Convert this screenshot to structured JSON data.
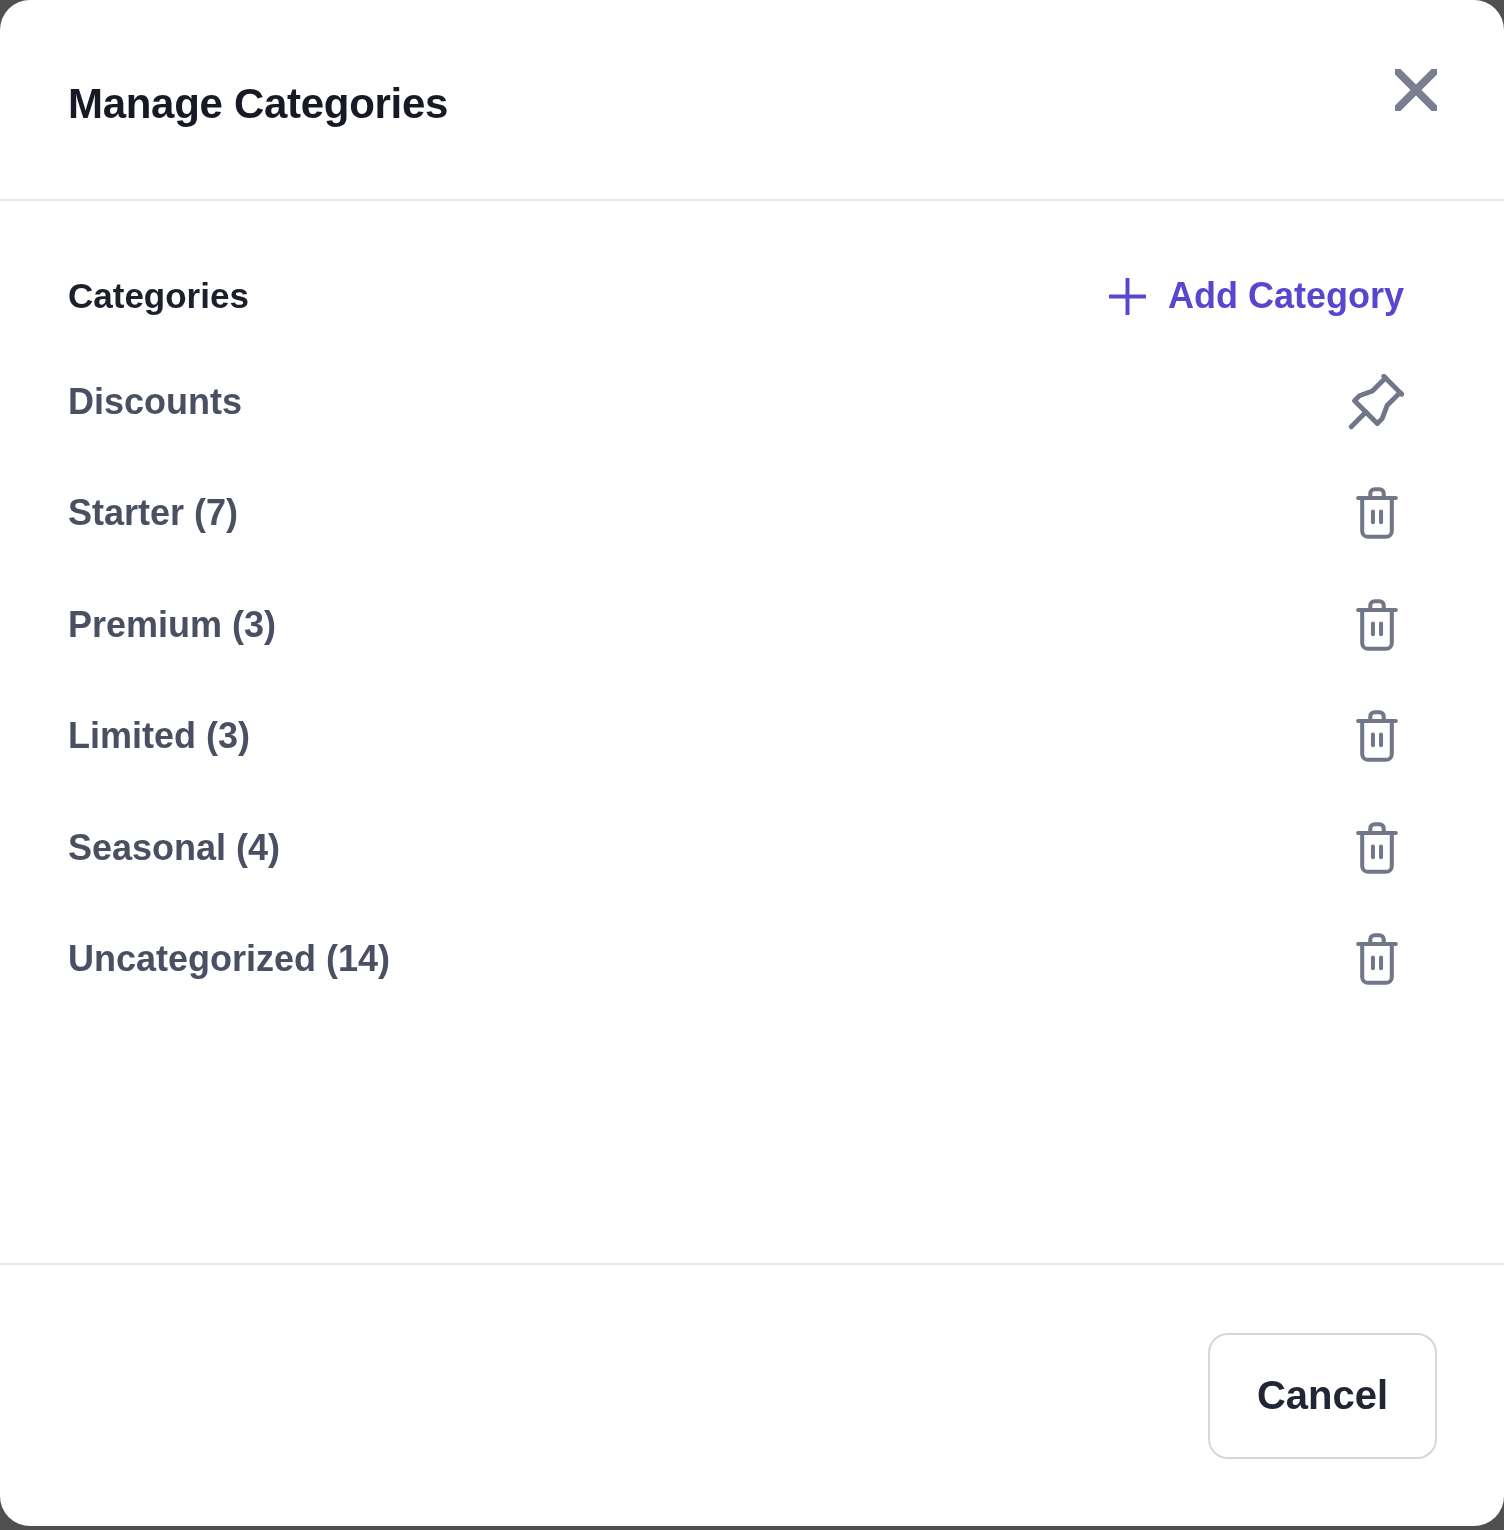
{
  "dialog": {
    "title": "Manage Categories"
  },
  "section": {
    "label": "Categories",
    "add_button": "Add Category"
  },
  "categories": [
    {
      "label": "Discounts",
      "kind": "pinned"
    },
    {
      "label": "Starter (7)",
      "kind": "deletable"
    },
    {
      "label": "Premium (3)",
      "kind": "deletable"
    },
    {
      "label": "Limited (3)",
      "kind": "deletable"
    },
    {
      "label": "Seasonal (4)",
      "kind": "deletable"
    },
    {
      "label": "Uncategorized (14)",
      "kind": "deletable"
    }
  ],
  "footer": {
    "cancel_button": "Cancel"
  }
}
